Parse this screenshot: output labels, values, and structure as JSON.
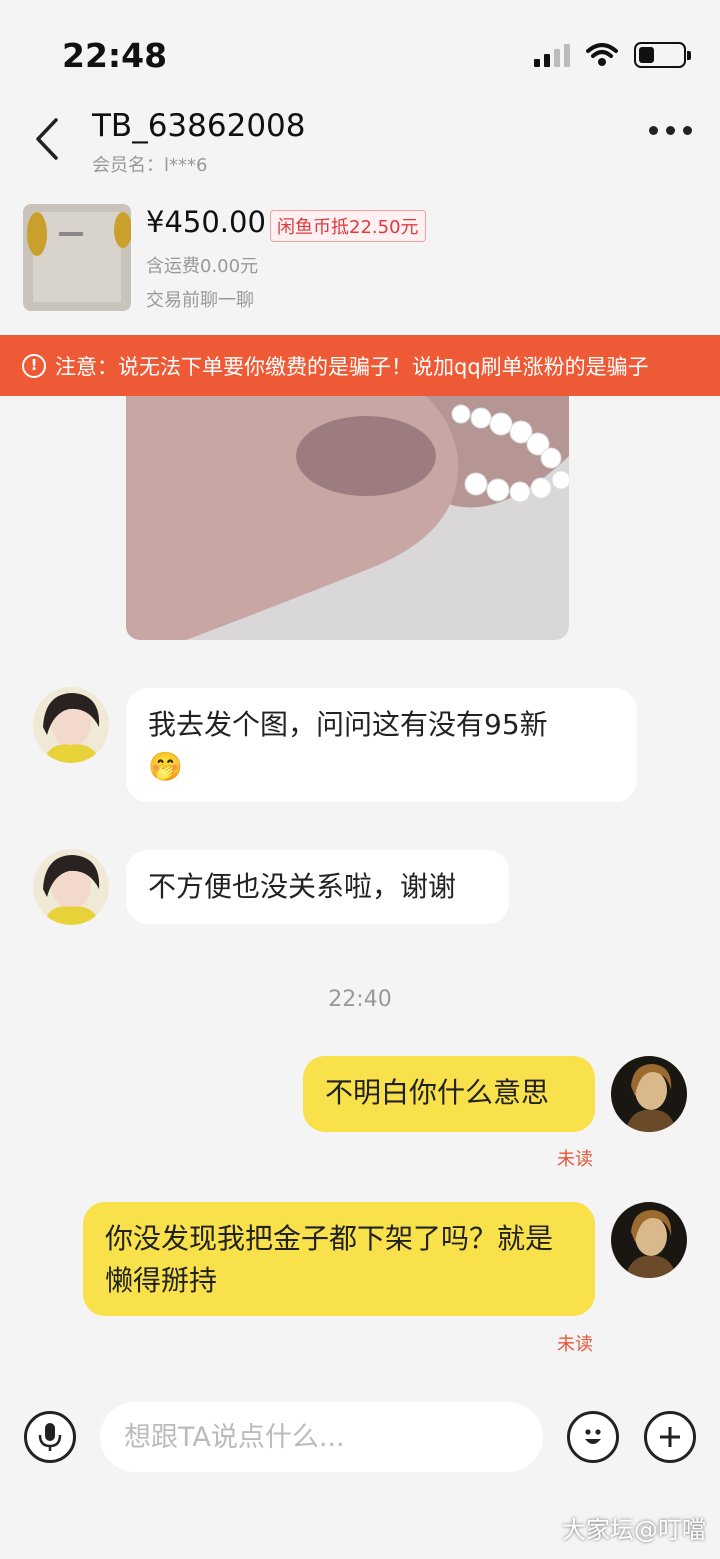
{
  "status_bar": {
    "time": "22:48"
  },
  "header": {
    "title": "TB_63862008",
    "member_name": "会员名：l***6"
  },
  "product": {
    "price": "¥450.00",
    "coin_discount": "闲鱼币抵22.50元",
    "shipping": "含运费0.00元",
    "chat_hint": "交易前聊一聊"
  },
  "warning": {
    "text": "注意：说无法下单要你缴费的是骗子！说加qq刷单涨粉的是骗子"
  },
  "messages": [
    {
      "side": "left",
      "text": "我去发个图，问问这有没有95新",
      "emoji": "🤭"
    },
    {
      "side": "left",
      "text": "不方便也没关系啦，谢谢"
    },
    {
      "side": "right",
      "text": "不明白你什么意思",
      "status": "未读"
    },
    {
      "side": "right",
      "text": "你没发现我把金子都下架了吗？就是懒得掰持",
      "status": "未读"
    }
  ],
  "timestamp": "22:40",
  "input": {
    "placeholder": "想跟TA说点什么..."
  },
  "watermark": "大家坛@叮噹",
  "colors": {
    "warning_bg": "#ef5a36",
    "bubble_mine": "#f8e14a",
    "unread": "#e5573b",
    "badge_red": "#e0393e"
  },
  "icons": [
    "signal-icon",
    "wifi-icon",
    "battery-icon",
    "back-icon",
    "more-icon",
    "alert-icon",
    "microphone-icon",
    "emoji-icon",
    "plus-icon"
  ]
}
